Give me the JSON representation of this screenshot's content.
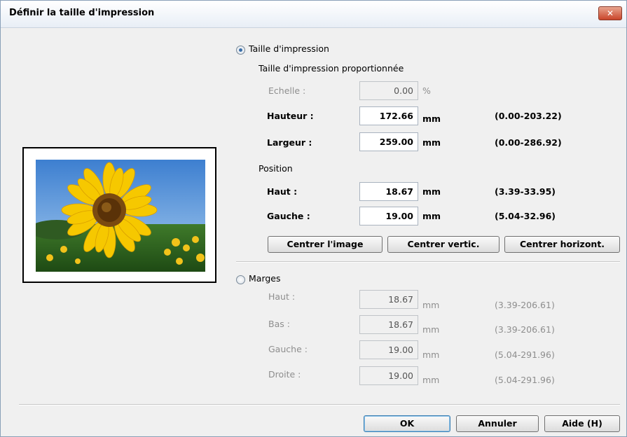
{
  "window": {
    "title": "Définir la taille d'impression",
    "close_label": "✕"
  },
  "print_size": {
    "radio_label": "Taille d'impression",
    "proportional_heading": "Taille d'impression proportionnée",
    "scale": {
      "label": "Echelle :",
      "value": "0.00",
      "unit": "%"
    },
    "height": {
      "label": "Hauteur :",
      "value": "172.66",
      "unit": "mm",
      "range": "(0.00-203.22)"
    },
    "width": {
      "label": "Largeur :",
      "value": "259.00",
      "unit": "mm",
      "range": "(0.00-286.92)"
    },
    "position_heading": "Position",
    "top": {
      "label": "Haut :",
      "value": "18.67",
      "unit": "mm",
      "range": "(3.39-33.95)"
    },
    "left": {
      "label": "Gauche :",
      "value": "19.00",
      "unit": "mm",
      "range": "(5.04-32.96)"
    },
    "buttons": {
      "center_image": "Centrer l'image",
      "center_vertical": "Centrer vertic.",
      "center_horizontal": "Centrer horizont."
    }
  },
  "margins": {
    "radio_label": "Marges",
    "top": {
      "label": "Haut :",
      "value": "18.67",
      "unit": "mm",
      "range": "(3.39-206.61)"
    },
    "bottom": {
      "label": "Bas :",
      "value": "18.67",
      "unit": "mm",
      "range": "(3.39-206.61)"
    },
    "left": {
      "label": "Gauche :",
      "value": "19.00",
      "unit": "mm",
      "range": "(5.04-291.96)"
    },
    "right": {
      "label": "Droite :",
      "value": "19.00",
      "unit": "mm",
      "range": "(5.04-291.96)"
    }
  },
  "footer": {
    "ok": "OK",
    "cancel": "Annuler",
    "help": "Aide (H)"
  },
  "colors": {
    "accent": "#3a6ea8",
    "close": "#c9452a"
  }
}
